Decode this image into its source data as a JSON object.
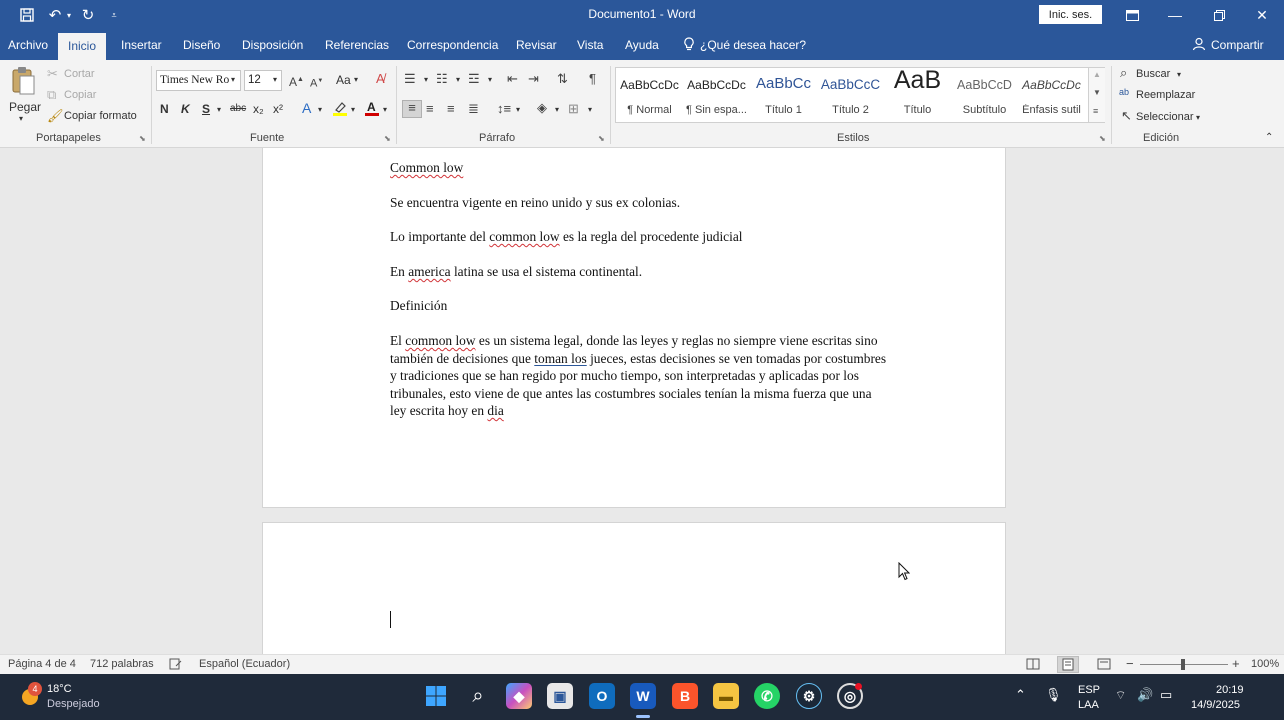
{
  "titlebar": {
    "title": "Documento1 - Word",
    "signin": "Inic. ses."
  },
  "menu": {
    "tabs": [
      "Archivo",
      "Inicio",
      "Insertar",
      "Diseño",
      "Disposición",
      "Referencias",
      "Correspondencia",
      "Revisar",
      "Vista",
      "Ayuda"
    ],
    "active_tab": "Inicio",
    "tell_me": "¿Qué desea hacer?",
    "share": "Compartir"
  },
  "ribbon": {
    "clipboard": {
      "group": "Portapapeles",
      "paste": "Pegar",
      "cut": "Cortar",
      "copy": "Copiar",
      "format_painter": "Copiar formato"
    },
    "font": {
      "group": "Fuente",
      "font_name": "Times New Ro",
      "font_size": "12",
      "case": "Aa",
      "bold": "N",
      "italic": "K",
      "underline": "S",
      "strike": "abc",
      "subscript": "x₂",
      "superscript": "x²"
    },
    "paragraph": {
      "group": "Párrafo"
    },
    "styles": {
      "group": "Estilos",
      "items": [
        {
          "preview": "AaBbCcDc",
          "label": "¶ Normal"
        },
        {
          "preview": "AaBbCcDc",
          "label": "¶ Sin espa..."
        },
        {
          "preview": "AaBbCc",
          "label": "Título 1"
        },
        {
          "preview": "AaBbCcC",
          "label": "Título 2"
        },
        {
          "preview": "AaB",
          "label": "Título"
        },
        {
          "preview": "AaBbCcD",
          "label": "Subtítulo"
        },
        {
          "preview": "AaBbCcDc",
          "label": "Énfasis sutil"
        }
      ]
    },
    "editing": {
      "group": "Edición",
      "find": "Buscar",
      "replace": "Reemplazar",
      "select": "Seleccionar"
    }
  },
  "document": {
    "heading": "Common low",
    "p1": "Se encuentra vigente en reino unido y sus ex colonias.",
    "p2_a": "Lo importante del ",
    "p2_b": "common low",
    "p2_c": " es la regla del procedente judicial",
    "p3_a": "En ",
    "p3_b": "america",
    "p3_c": " latina se usa el sistema continental.",
    "p4": "Definición",
    "p5_a": "El ",
    "p5_b": "common low",
    "p5_c": " es un sistema legal, donde las leyes y reglas no siempre viene escritas sino también de decisiones que ",
    "p5_d": "toman  los",
    "p5_e": " jueces, estas decisiones se ven tomadas por costumbres y tradiciones que se han regido por mucho tiempo, son interpretadas y aplicadas por los tribunales, esto viene de que antes las costumbres sociales tenían la misma fuerza que una ley escrita hoy en ",
    "p5_f": "dia"
  },
  "statusbar": {
    "page": "Página 4 de 4",
    "words": "712 palabras",
    "language": "Español (Ecuador)",
    "zoom": "100%"
  },
  "taskbar": {
    "weather_temp": "18°C",
    "weather_desc": "Despejado",
    "weather_badge": "4",
    "lang_1": "ESP",
    "lang_2": "LAA",
    "time": "20:19",
    "date": "14/9/2025"
  },
  "colors": {
    "accent": "#2b579a",
    "ribbon_bg": "#f3f3f3",
    "doc_bg": "#e9e9e9",
    "taskbar_bg": "#1f2a3a"
  }
}
